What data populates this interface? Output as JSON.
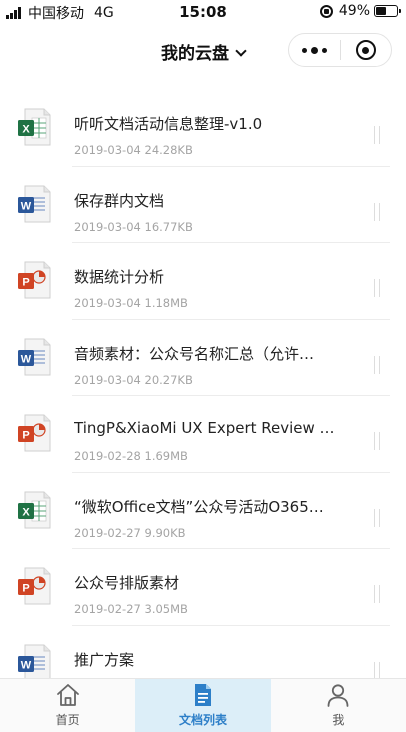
{
  "status_bar": {
    "carrier": "中国移动",
    "network": "4G",
    "time": "15:08",
    "battery": "49%",
    "battery_level": 0.49
  },
  "header": {
    "title": "我的云盘"
  },
  "files": [
    {
      "name": "听听文档活动信息整理-v1.0",
      "date": "2019-03-04",
      "size": "24.28KB",
      "type": "excel"
    },
    {
      "name": "保存群内文档",
      "date": "2019-03-04",
      "size": "16.77KB",
      "type": "word"
    },
    {
      "name": "数据统计分析",
      "date": "2019-03-04",
      "size": "1.18MB",
      "type": "powerpoint"
    },
    {
      "name": "音频素材：公众号名称汇总（允许…",
      "date": "2019-03-04",
      "size": "20.27KB",
      "type": "word"
    },
    {
      "name": "TingP&XiaoMi UX Expert Review …",
      "date": "2019-02-28",
      "size": "1.69MB",
      "type": "powerpoint"
    },
    {
      "name": "“微软Office文档”公众号活动O365…",
      "date": "2019-02-27",
      "size": "9.90KB",
      "type": "excel"
    },
    {
      "name": "公众号排版素材",
      "date": "2019-02-27",
      "size": "3.05MB",
      "type": "powerpoint"
    },
    {
      "name": "推广方案",
      "date": "",
      "size": "",
      "type": "word"
    }
  ],
  "tabs": [
    {
      "label": "首页",
      "icon": "home-icon"
    },
    {
      "label": "文档列表",
      "icon": "document-list-icon",
      "active": true
    },
    {
      "label": "我",
      "icon": "person-icon"
    }
  ],
  "colors": {
    "excel": "#1f7244",
    "word": "#2b579a",
    "powerpoint": "#d04424",
    "accent": "#2d7fc8",
    "active_tab_bg": "#dceef8"
  }
}
